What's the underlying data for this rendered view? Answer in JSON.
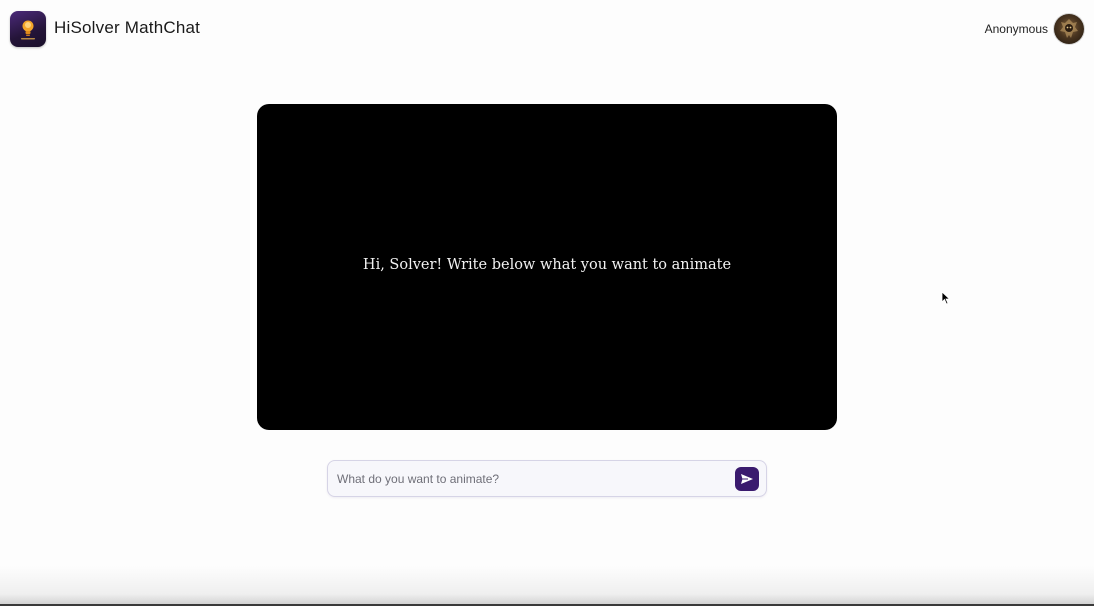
{
  "header": {
    "app_title": "HiSolver MathChat",
    "logo_icon": "lightbulb-icon",
    "user_name": "Anonymous",
    "avatar_icon": "avatar-image"
  },
  "player": {
    "message": "Hi, Solver! Write below what you want to animate"
  },
  "prompt": {
    "placeholder": "What do you want to animate?",
    "value": "",
    "send_icon": "send-icon"
  },
  "colors": {
    "accent": "#3a1a6e",
    "player_background": "#000000",
    "page_background": "#fdfdfd"
  }
}
